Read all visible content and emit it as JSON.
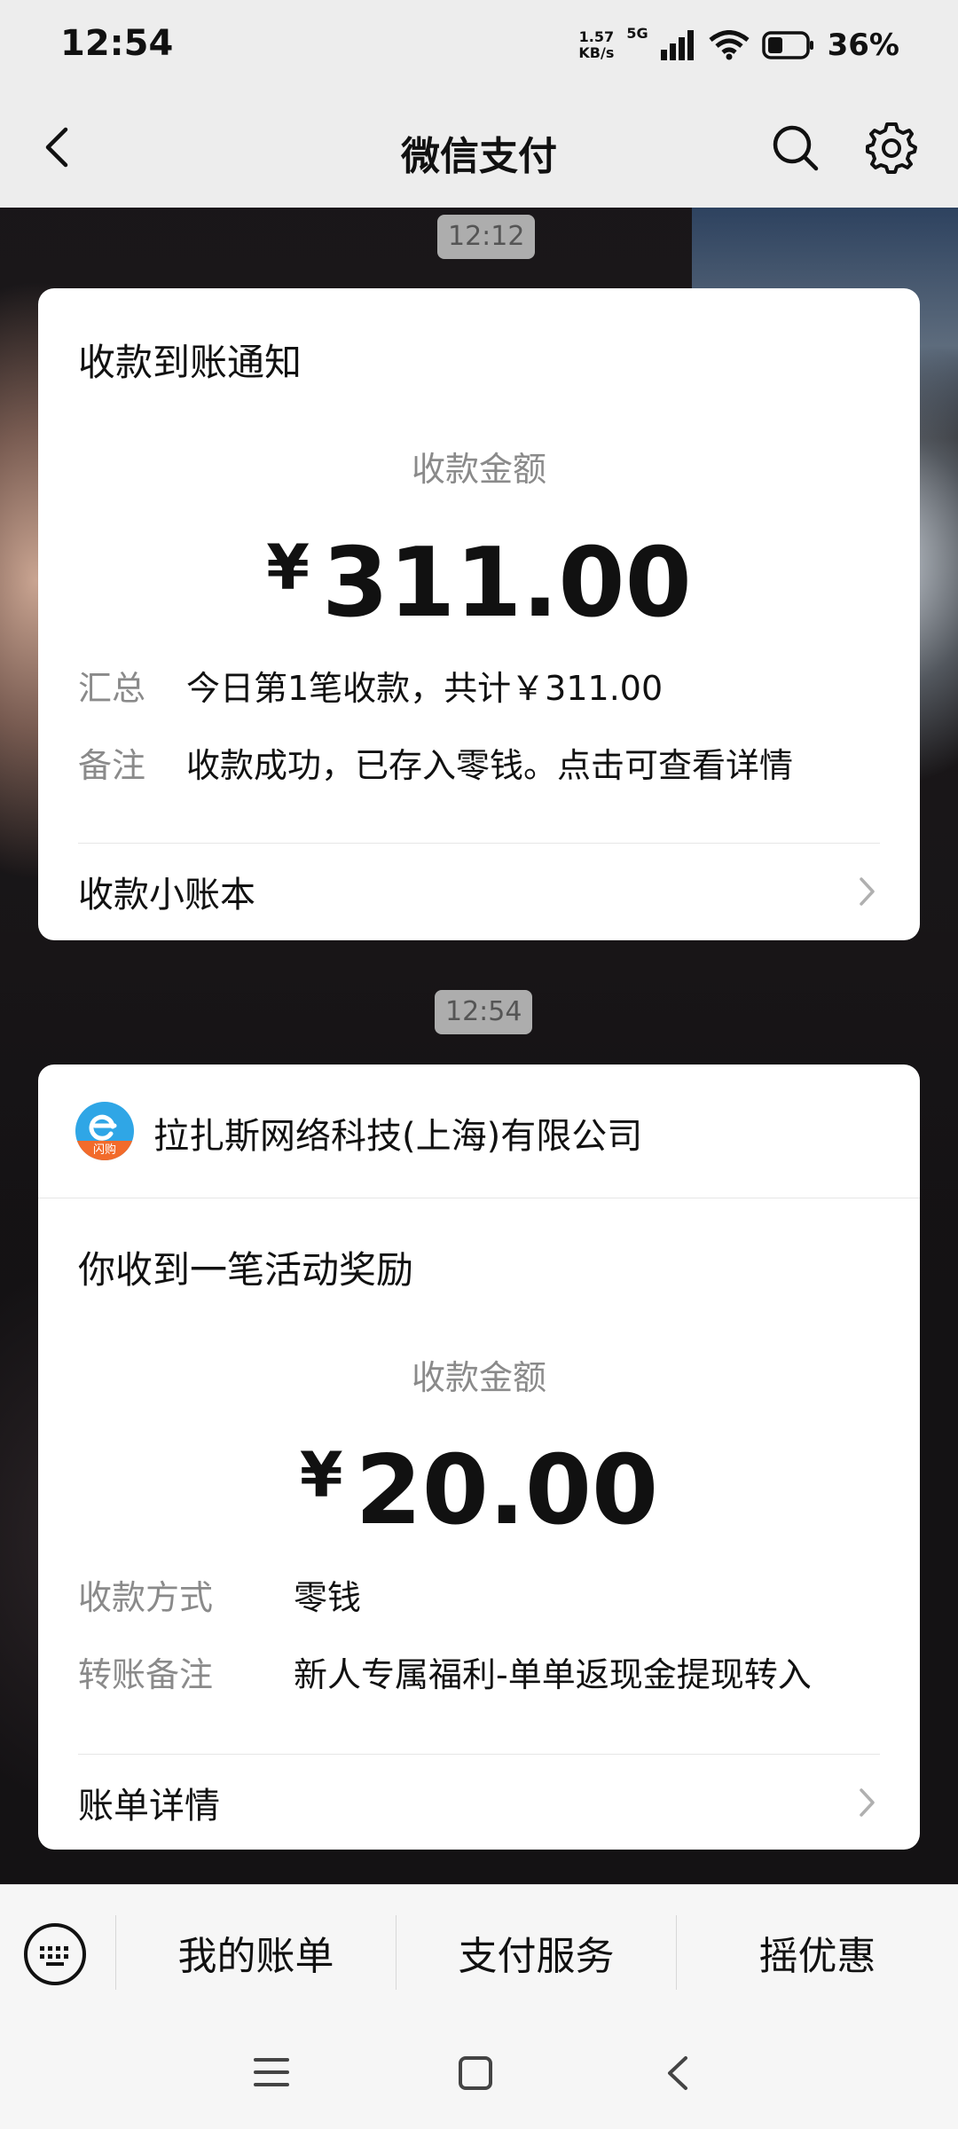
{
  "status": {
    "time": "12:54",
    "net_speed_value": "1.57",
    "net_speed_unit": "KB/s",
    "network": "5G",
    "battery": "36%"
  },
  "nav": {
    "title": "微信支付",
    "back_icon": "back-chevron-icon",
    "search_icon": "search-icon",
    "settings_icon": "gear-icon"
  },
  "messages": [
    {
      "time": "12:12",
      "title": "收款到账通知",
      "amount_label": "收款金额",
      "currency": "¥",
      "amount": "311.00",
      "fields": [
        {
          "key": "汇总",
          "value": "今日第1笔收款，共计￥311.00"
        },
        {
          "key": "备注",
          "value": "收款成功，已存入零钱。点击可查看详情"
        }
      ],
      "link": "收款小账本"
    },
    {
      "time": "12:54",
      "merchant": "拉扎斯网络科技(上海)有限公司",
      "merchant_logo_text": "闪购",
      "title": "你收到一笔活动奖励",
      "amount_label": "收款金额",
      "currency": "¥",
      "amount": "20.00",
      "fields": [
        {
          "key": "收款方式",
          "value": "零钱"
        },
        {
          "key": "转账备注",
          "value": "新人专属福利-单单返现金提现转入"
        }
      ],
      "link": "账单详情"
    }
  ],
  "bottom_menu": {
    "keyboard_icon": "keyboard-icon",
    "items": [
      "我的账单",
      "支付服务",
      "摇优惠"
    ]
  },
  "colors": {
    "page_bg": "#ededed",
    "card_bg": "#ffffff",
    "muted_text": "#8a8a8a",
    "logo_blue": "#2fa6e6",
    "logo_orange": "#f26b2b"
  }
}
